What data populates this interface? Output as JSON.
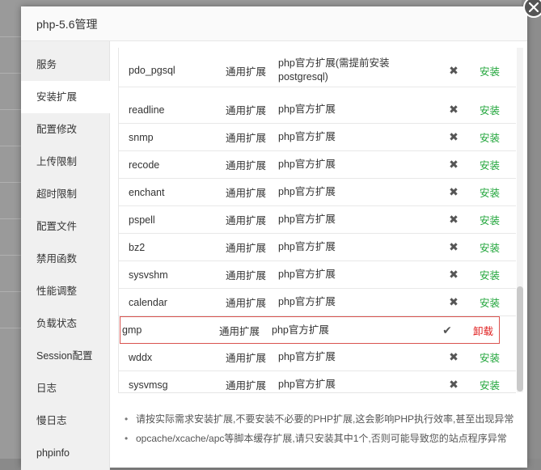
{
  "dialog": {
    "title": "php-5.6管理"
  },
  "sidebar": {
    "items": [
      {
        "label": "服务"
      },
      {
        "label": "安装扩展",
        "active": true
      },
      {
        "label": "配置修改"
      },
      {
        "label": "上传限制"
      },
      {
        "label": "超时限制"
      },
      {
        "label": "配置文件"
      },
      {
        "label": "禁用函数"
      },
      {
        "label": "性能调整"
      },
      {
        "label": "负载状态"
      },
      {
        "label": "Session配置"
      },
      {
        "label": "日志"
      },
      {
        "label": "慢日志"
      },
      {
        "label": "phpinfo"
      }
    ]
  },
  "extensions": {
    "rows": [
      {
        "name": "pdo_pgsql",
        "type": "通用扩展",
        "desc": "php官方扩展(需提前安装postgresql)",
        "status": "✖",
        "action": "安装"
      },
      {
        "name": "readline",
        "type": "通用扩展",
        "desc": "php官方扩展",
        "status": "✖",
        "action": "安装"
      },
      {
        "name": "snmp",
        "type": "通用扩展",
        "desc": "php官方扩展",
        "status": "✖",
        "action": "安装"
      },
      {
        "name": "recode",
        "type": "通用扩展",
        "desc": "php官方扩展",
        "status": "✖",
        "action": "安装"
      },
      {
        "name": "enchant",
        "type": "通用扩展",
        "desc": "php官方扩展",
        "status": "✖",
        "action": "安装"
      },
      {
        "name": "pspell",
        "type": "通用扩展",
        "desc": "php官方扩展",
        "status": "✖",
        "action": "安装"
      },
      {
        "name": "bz2",
        "type": "通用扩展",
        "desc": "php官方扩展",
        "status": "✖",
        "action": "安装"
      },
      {
        "name": "sysvshm",
        "type": "通用扩展",
        "desc": "php官方扩展",
        "status": "✖",
        "action": "安装"
      },
      {
        "name": "calendar",
        "type": "通用扩展",
        "desc": "php官方扩展",
        "status": "✖",
        "action": "安装"
      },
      {
        "name": "gmp",
        "type": "通用扩展",
        "desc": "php官方扩展",
        "status": "✔",
        "action": "卸载"
      },
      {
        "name": "wddx",
        "type": "通用扩展",
        "desc": "php官方扩展",
        "status": "✖",
        "action": "安装"
      },
      {
        "name": "sysvmsg",
        "type": "通用扩展",
        "desc": "php官方扩展",
        "status": "✖",
        "action": "安装"
      }
    ]
  },
  "tips": [
    "请按实际需求安装扩展,不要安装不必要的PHP扩展,这会影响PHP执行效率,甚至出现异常",
    "opcache/xcache/apc等脚本缓存扩展,请只安装其中1个,否则可能导致您的站点程序异常"
  ],
  "colors": {
    "install": "#20a53a",
    "uninstall": "#e02020",
    "highlight_border": "#d9534f"
  }
}
